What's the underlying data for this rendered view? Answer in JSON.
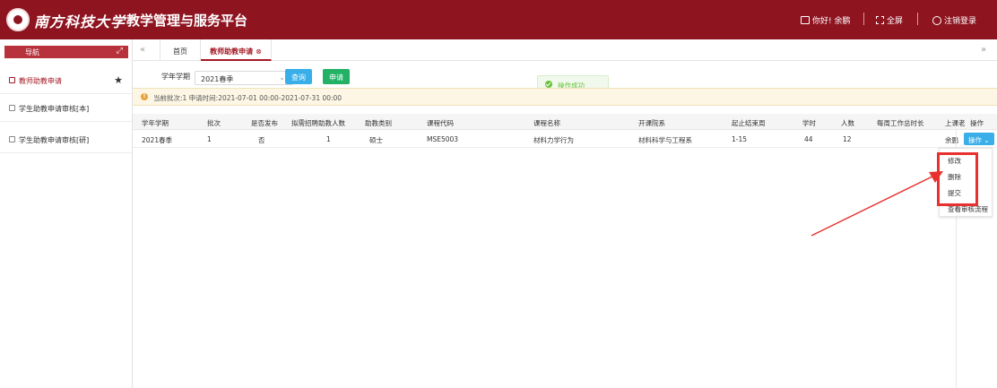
{
  "header": {
    "school_name": "南方科技大学",
    "platform_title": "教学管理与服务平台",
    "greeting": "你好! 余鹏",
    "fullscreen": "全屏",
    "logout": "注销登录"
  },
  "sidebar": {
    "nav_title": "导航",
    "items": [
      {
        "label": "教师助教申请"
      },
      {
        "label": "学生助教申请审核[本]"
      },
      {
        "label": "学生助教申请审核[研]"
      }
    ]
  },
  "tabs": {
    "home": "首页",
    "current": "教师助教申请",
    "close_glyph": "⊗"
  },
  "toolbar": {
    "term_label": "学年学期",
    "term_value": "2021春季",
    "query_label": "查询",
    "apply_label": "申请"
  },
  "toast": {
    "text": "操作成功"
  },
  "notice": {
    "text": "当前批次:1  申请时间:2021-07-01 00:00-2021-07-31 00:00"
  },
  "table": {
    "headers": [
      "学年学期",
      "批次",
      "是否发布",
      "拟需招聘助教人数",
      "助教类别",
      "课程代码",
      "课程名称",
      "开课院系",
      "起止结束周",
      "学时",
      "人数",
      "每周工作总时长",
      "上课老",
      "操作"
    ],
    "rows": [
      [
        "2021春季",
        "1",
        "否",
        "1",
        "硕士",
        "MSE5003",
        "材料力学行为",
        "材料科学与工程系",
        "1-15",
        "44",
        "12",
        "",
        "余鹏"
      ]
    ],
    "op_button": "操作"
  },
  "dropdown": {
    "items": [
      "修改",
      "删除",
      "提交",
      "查看审核流程"
    ]
  },
  "colors": {
    "brand": "#8e1420",
    "nav": "#b7323c",
    "query": "#3aaee8",
    "apply": "#22b165",
    "highlight": "#e8312e"
  }
}
